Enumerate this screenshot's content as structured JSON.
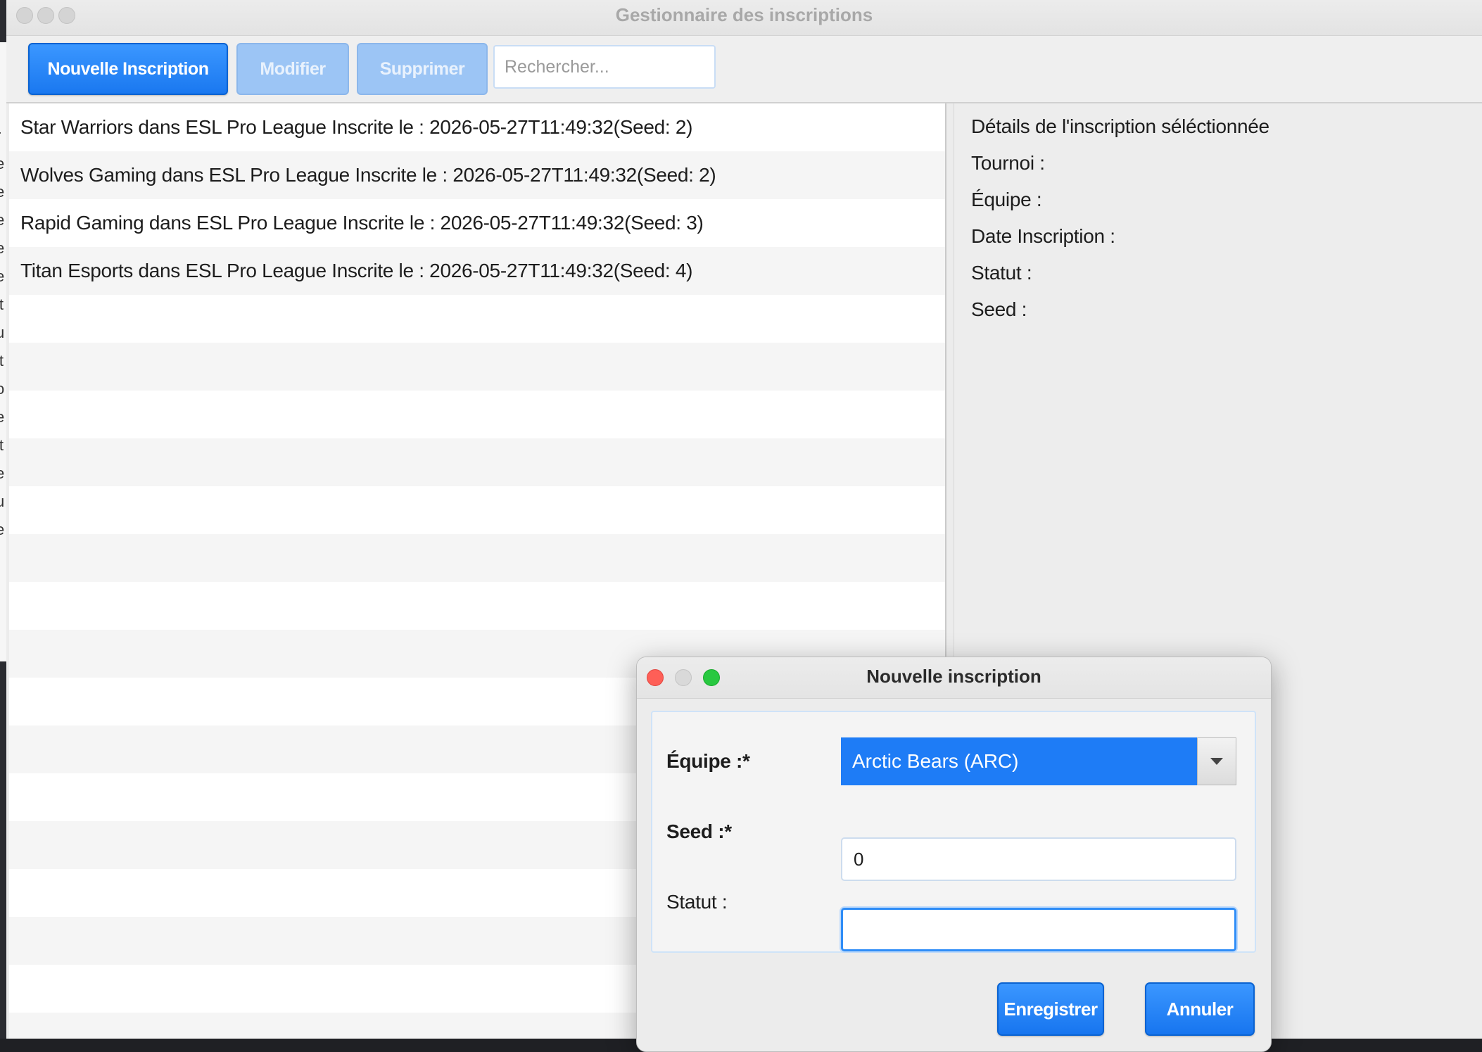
{
  "window": {
    "title": "Gestionnaire des inscriptions"
  },
  "toolbar": {
    "new_label": "Nouvelle Inscription",
    "edit_label": "Modifier",
    "delete_label": "Supprimer",
    "search_placeholder": "Rechercher...",
    "search_value": ""
  },
  "registrations": [
    "Star Warriors dans ESL Pro League Inscrite le : 2026-05-27T11:49:32(Seed: 2)",
    "Wolves Gaming dans ESL Pro League Inscrite le : 2026-05-27T11:49:32(Seed: 2)",
    "Rapid Gaming dans ESL Pro League Inscrite le : 2026-05-27T11:49:32(Seed: 3)",
    "Titan Esports dans ESL Pro League Inscrite le : 2026-05-27T11:49:32(Seed: 4)",
    "",
    "",
    "",
    "",
    "",
    "",
    "",
    "",
    "",
    "",
    "",
    "",
    "",
    "",
    "",
    ""
  ],
  "details": {
    "heading": "Détails de l'inscription séléctionnée",
    "tournoi_label": "Tournoi :",
    "equipe_label": "Équipe :",
    "date_label": "Date Inscription :",
    "statut_label": "Statut :",
    "seed_label": "Seed :"
  },
  "dialog": {
    "title": "Nouvelle inscription",
    "equipe_label": "Équipe :*",
    "equipe_value": "Arctic Bears (ARC)",
    "seed_label": "Seed :*",
    "seed_value": "0",
    "statut_label": "Statut :",
    "statut_value": "",
    "save_label": "Enregistrer",
    "cancel_label": "Annuler"
  },
  "background_strip_chars": [
    "r",
    "e",
    "e",
    "e",
    "e",
    "e",
    "lt",
    "u",
    "lt",
    "o",
    "e",
    "lt",
    "e",
    "u",
    "e"
  ],
  "colors": {
    "accent": "#1e7cf6",
    "close": "#fe5f57",
    "minimize": "#d9d9d9",
    "zoom": "#28c840"
  }
}
